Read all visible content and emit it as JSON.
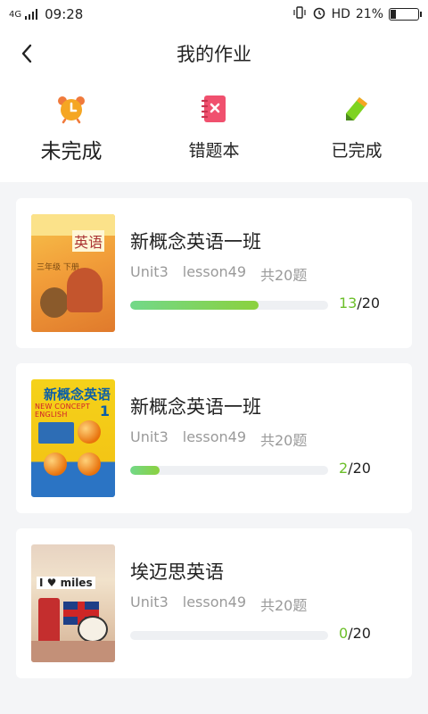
{
  "status_bar": {
    "network": "4G",
    "time": "09:28",
    "hd": "HD",
    "battery": "21%",
    "battery_level": 0.21
  },
  "header": {
    "title": "我的作业"
  },
  "tabs": [
    {
      "label": "未完成",
      "active": true
    },
    {
      "label": "错题本",
      "active": false
    },
    {
      "label": "已完成",
      "active": false
    }
  ],
  "courses": [
    {
      "name": "新概念英语一班",
      "unit": "Unit3",
      "lesson": "lesson49",
      "total_label": "共20题",
      "done": "13",
      "total": "/20",
      "progress": 0.65,
      "cover_text": {
        "word": "英语",
        "grade": "三年级 下册"
      }
    },
    {
      "name": "新概念英语一班",
      "unit": "Unit3",
      "lesson": "lesson49",
      "total_label": "共20题",
      "done": "2",
      "total": "/20",
      "progress": 0.15,
      "cover_text": {
        "title": "新概念英语",
        "subtitle": "NEW CONCEPT ENGLISH",
        "num": "1"
      }
    },
    {
      "name": "埃迈思英语",
      "unit": "Unit3",
      "lesson": "lesson49",
      "total_label": "共20题",
      "done": "0",
      "total": "/20",
      "progress": 0,
      "cover_text": {
        "logo": "I ♥ miles"
      }
    }
  ],
  "colors": {
    "accent_green": "#8bd13e",
    "progress_gradient_start": "#72d889",
    "clock_icon": "#f5a623",
    "notebook_icon": "#f0506e",
    "pencil_icon": "#7ed321"
  }
}
